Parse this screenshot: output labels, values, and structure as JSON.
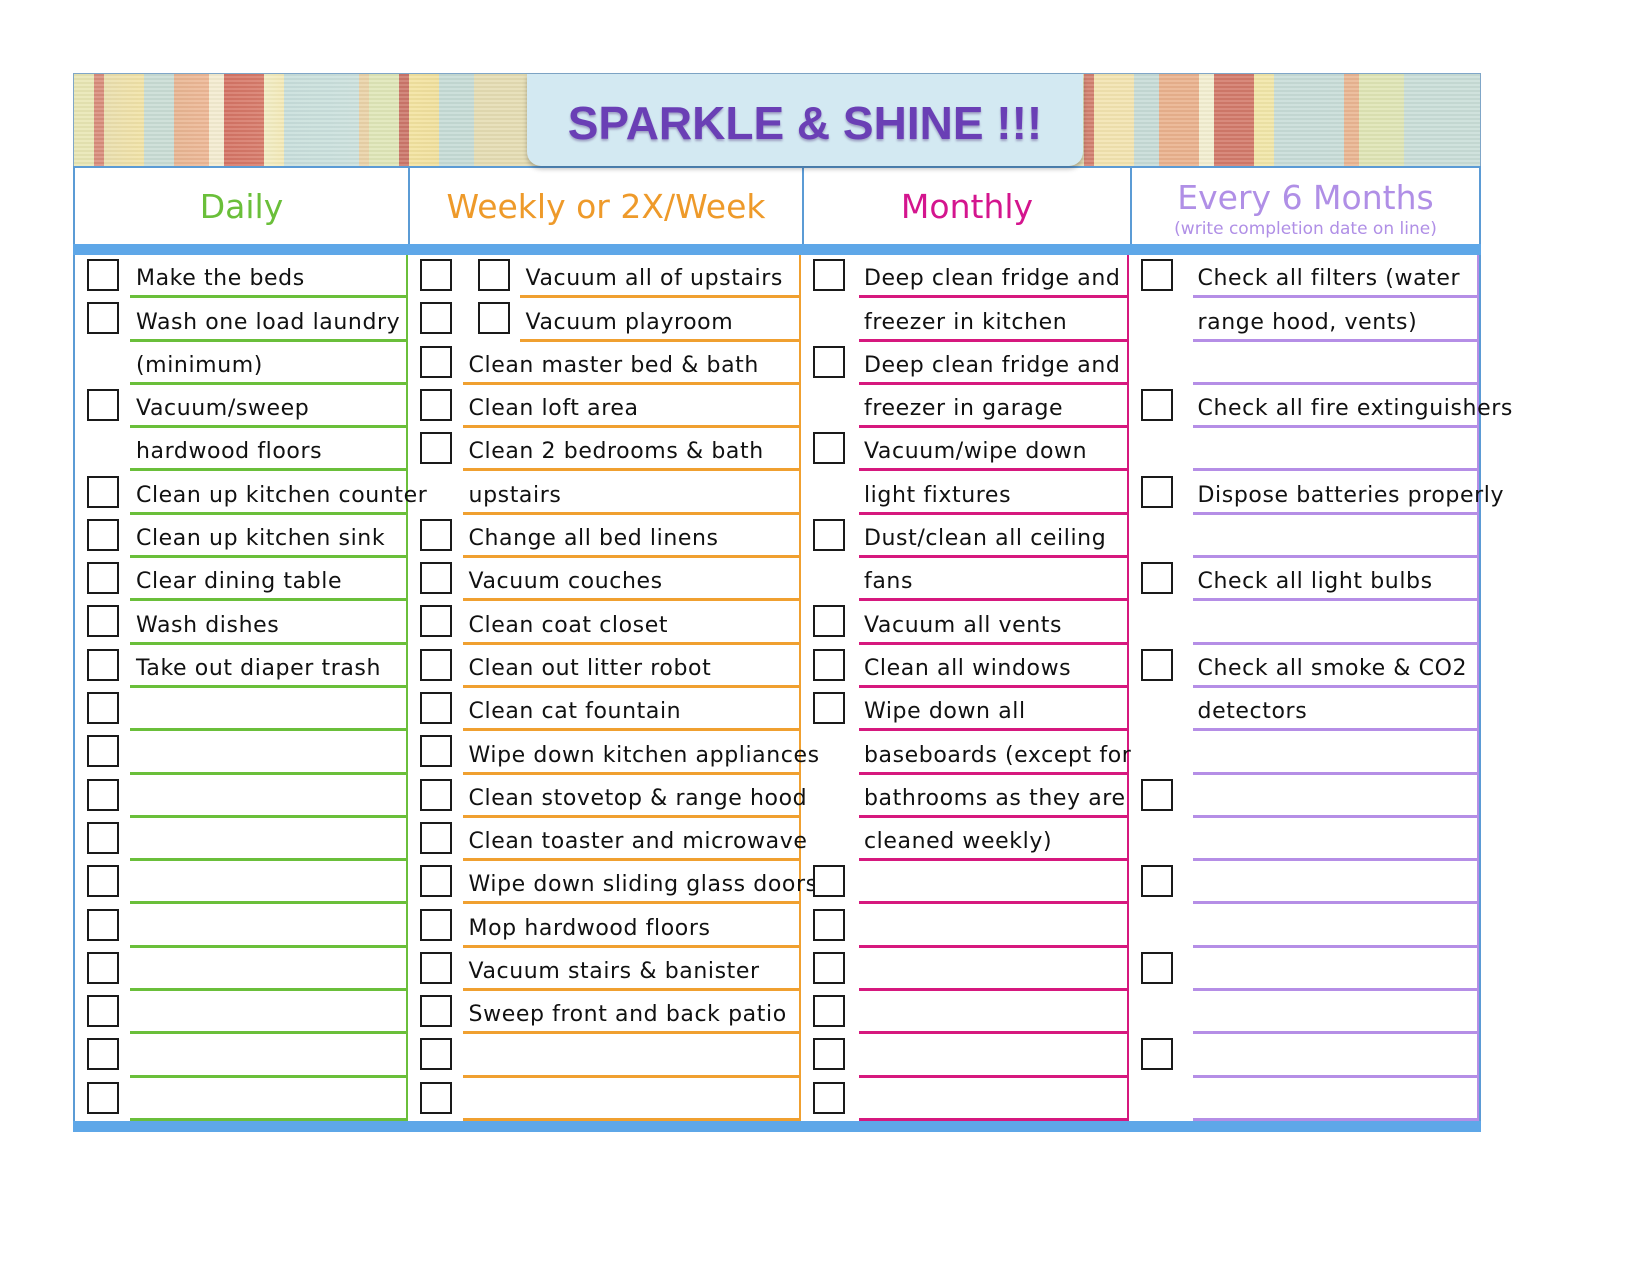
{
  "title": "SPARKLE & SHINE !!!",
  "colors": {
    "daily": "#6abf3a",
    "weekly": "#f0a030",
    "monthly": "#d6187e",
    "six_months": "#b58ee6",
    "bar": "#5ea7e8",
    "title": "#6a3fb5"
  },
  "columns": [
    {
      "key": "daily",
      "title": "Daily",
      "subtitle": "",
      "color": "#6abf3a",
      "title_color": "#6abf3a"
    },
    {
      "key": "weekly",
      "title": "Weekly or 2X/Week",
      "subtitle": "",
      "color": "#f0a030",
      "title_color": "#ee9a2a"
    },
    {
      "key": "monthly",
      "title": "Monthly",
      "subtitle": "",
      "color": "#d6187e",
      "title_color": "#d4158e"
    },
    {
      "key": "six_months",
      "title": "Every 6 Months",
      "subtitle": "(write completion date on line)",
      "color": "#b58ee6",
      "title_color": "#b08fe6"
    }
  ],
  "daily_rows": [
    {
      "checkbox": true,
      "text": "Make the beds"
    },
    {
      "checkbox": true,
      "text": "Wash one load laundry"
    },
    {
      "checkbox": false,
      "text": "(minimum)"
    },
    {
      "checkbox": true,
      "text": "Vacuum/sweep"
    },
    {
      "checkbox": false,
      "text": "hardwood floors"
    },
    {
      "checkbox": true,
      "text": "Clean up kitchen counter"
    },
    {
      "checkbox": true,
      "text": "Clean up kitchen sink"
    },
    {
      "checkbox": true,
      "text": "Clear dining table"
    },
    {
      "checkbox": true,
      "text": "Wash dishes"
    },
    {
      "checkbox": true,
      "text": "Take out diaper trash"
    },
    {
      "checkbox": true,
      "text": ""
    },
    {
      "checkbox": true,
      "text": ""
    },
    {
      "checkbox": true,
      "text": ""
    },
    {
      "checkbox": true,
      "text": ""
    },
    {
      "checkbox": true,
      "text": ""
    },
    {
      "checkbox": true,
      "text": ""
    },
    {
      "checkbox": true,
      "text": ""
    },
    {
      "checkbox": true,
      "text": ""
    },
    {
      "checkbox": true,
      "text": ""
    },
    {
      "checkbox": true,
      "text": ""
    }
  ],
  "weekly_rows": [
    {
      "checkbox": true,
      "checkbox2": true,
      "text": "Vacuum all of upstairs"
    },
    {
      "checkbox": true,
      "checkbox2": true,
      "text": "Vacuum playroom"
    },
    {
      "checkbox": true,
      "text": "Clean master bed & bath"
    },
    {
      "checkbox": true,
      "text": "Clean loft area"
    },
    {
      "checkbox": true,
      "text": "Clean 2 bedrooms & bath"
    },
    {
      "checkbox": false,
      "text": "upstairs"
    },
    {
      "checkbox": true,
      "text": "Change all bed linens"
    },
    {
      "checkbox": true,
      "text": "Vacuum couches"
    },
    {
      "checkbox": true,
      "text": "Clean coat closet"
    },
    {
      "checkbox": true,
      "text": "Clean out litter robot"
    },
    {
      "checkbox": true,
      "text": "Clean cat fountain"
    },
    {
      "checkbox": true,
      "text": "Wipe down kitchen appliances"
    },
    {
      "checkbox": true,
      "text": "Clean stovetop & range hood"
    },
    {
      "checkbox": true,
      "text": "Clean toaster and microwave"
    },
    {
      "checkbox": true,
      "text": "Wipe down sliding glass doors"
    },
    {
      "checkbox": true,
      "text": "Mop hardwood floors"
    },
    {
      "checkbox": true,
      "text": "Vacuum stairs & banister"
    },
    {
      "checkbox": true,
      "text": "Sweep front and back patio"
    },
    {
      "checkbox": true,
      "text": ""
    },
    {
      "checkbox": true,
      "text": ""
    }
  ],
  "monthly_rows": [
    {
      "checkbox": true,
      "text": "Deep clean fridge and"
    },
    {
      "checkbox": false,
      "text": "freezer in kitchen"
    },
    {
      "checkbox": true,
      "text": "Deep clean fridge and"
    },
    {
      "checkbox": false,
      "text": "freezer in garage"
    },
    {
      "checkbox": true,
      "text": "Vacuum/wipe down"
    },
    {
      "checkbox": false,
      "text": "light fixtures"
    },
    {
      "checkbox": true,
      "text": "Dust/clean all ceiling"
    },
    {
      "checkbox": false,
      "text": "fans"
    },
    {
      "checkbox": true,
      "text": "Vacuum all vents"
    },
    {
      "checkbox": true,
      "text": "Clean all windows"
    },
    {
      "checkbox": true,
      "text": "Wipe down all"
    },
    {
      "checkbox": false,
      "text": "baseboards (except for"
    },
    {
      "checkbox": false,
      "text": "bathrooms as they are"
    },
    {
      "checkbox": false,
      "text": "cleaned weekly)"
    },
    {
      "checkbox": true,
      "text": ""
    },
    {
      "checkbox": true,
      "text": ""
    },
    {
      "checkbox": true,
      "text": ""
    },
    {
      "checkbox": true,
      "text": ""
    },
    {
      "checkbox": true,
      "text": ""
    },
    {
      "checkbox": true,
      "text": ""
    }
  ],
  "six_month_rows": [
    {
      "checkbox": true,
      "text": "Check all filters (water"
    },
    {
      "checkbox": false,
      "text": "range hood, vents)"
    },
    {
      "checkbox": false,
      "text": ""
    },
    {
      "checkbox": true,
      "text": "Check all fire extinguishers"
    },
    {
      "checkbox": false,
      "text": ""
    },
    {
      "checkbox": true,
      "text": "Dispose batteries properly"
    },
    {
      "checkbox": false,
      "text": ""
    },
    {
      "checkbox": true,
      "text": "Check all light bulbs"
    },
    {
      "checkbox": false,
      "text": ""
    },
    {
      "checkbox": true,
      "text": "Check all smoke & CO2"
    },
    {
      "checkbox": false,
      "text": "detectors"
    },
    {
      "checkbox": false,
      "text": ""
    },
    {
      "checkbox": true,
      "text": ""
    },
    {
      "checkbox": false,
      "text": ""
    },
    {
      "checkbox": true,
      "text": ""
    },
    {
      "checkbox": false,
      "text": ""
    },
    {
      "checkbox": true,
      "text": ""
    },
    {
      "checkbox": false,
      "text": ""
    },
    {
      "checkbox": true,
      "text": ""
    },
    {
      "checkbox": false,
      "text": ""
    }
  ]
}
